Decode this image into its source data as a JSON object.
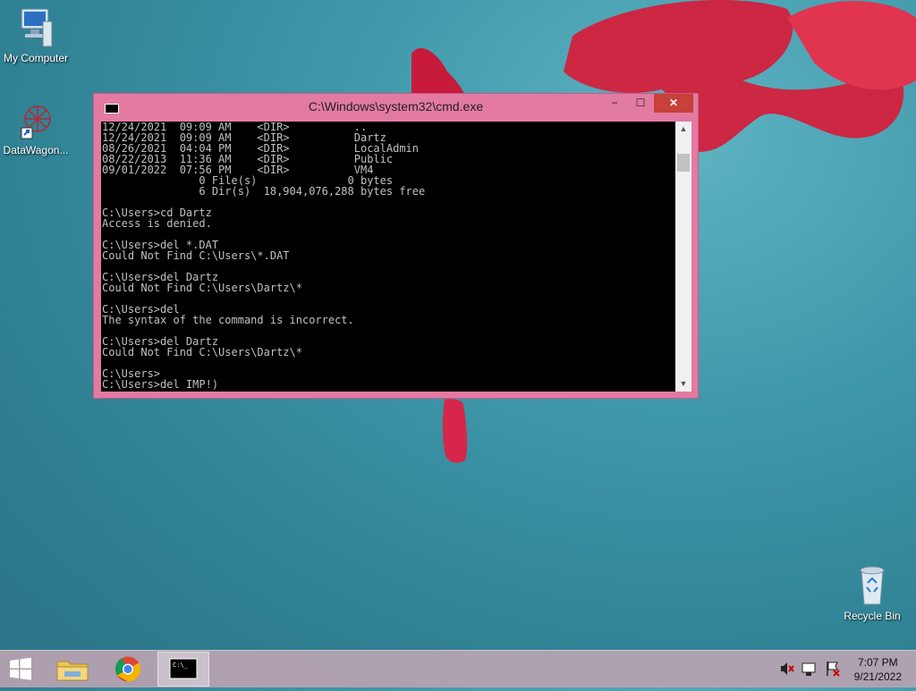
{
  "desktop": {
    "icons": [
      {
        "label": "My Computer",
        "icon": "computer-icon"
      },
      {
        "label": "DataWagon...",
        "icon": "app-shortcut-icon"
      },
      {
        "label": "Recycle Bin",
        "icon": "recycle-bin-icon"
      }
    ]
  },
  "window": {
    "title": "C:\\Windows\\system32\\cmd.exe",
    "minimize": "−",
    "maximize": "☐",
    "close": "✕",
    "console_lines": [
      "12/24/2021  09:09 AM    <DIR>          ..",
      "12/24/2021  09:09 AM    <DIR>          Dartz",
      "08/26/2021  04:04 PM    <DIR>          LocalAdmin",
      "08/22/2013  11:36 AM    <DIR>          Public",
      "09/01/2022  07:56 PM    <DIR>          VM4",
      "               0 File(s)              0 bytes",
      "               6 Dir(s)  18,904,076,288 bytes free",
      "",
      "C:\\Users>cd Dartz",
      "Access is denied.",
      "",
      "C:\\Users>del *.DAT",
      "Could Not Find C:\\Users\\*.DAT",
      "",
      "C:\\Users>del Dartz",
      "Could Not Find C:\\Users\\Dartz\\*",
      "",
      "C:\\Users>del",
      "The syntax of the command is incorrect.",
      "",
      "C:\\Users>del Dartz",
      "Could Not Find C:\\Users\\Dartz\\*",
      "",
      "C:\\Users>",
      "C:\\Users>del IMP!)"
    ]
  },
  "taskbar": {
    "items": [
      {
        "name": "start",
        "icon": "windows-start-icon"
      },
      {
        "name": "file-explorer",
        "icon": "folder-icon"
      },
      {
        "name": "chrome",
        "icon": "chrome-icon"
      },
      {
        "name": "cmd",
        "icon": "cmd-icon",
        "active": true
      }
    ],
    "tray_icons": [
      "speaker-muted-icon",
      "network-icon",
      "action-center-icon"
    ],
    "time": "7:07 PM",
    "date": "9/21/2022"
  },
  "colors": {
    "window_frame": "#e37aa2",
    "close_button": "#c7403a",
    "console_bg": "#000000",
    "console_fg": "#c0c0c0"
  }
}
